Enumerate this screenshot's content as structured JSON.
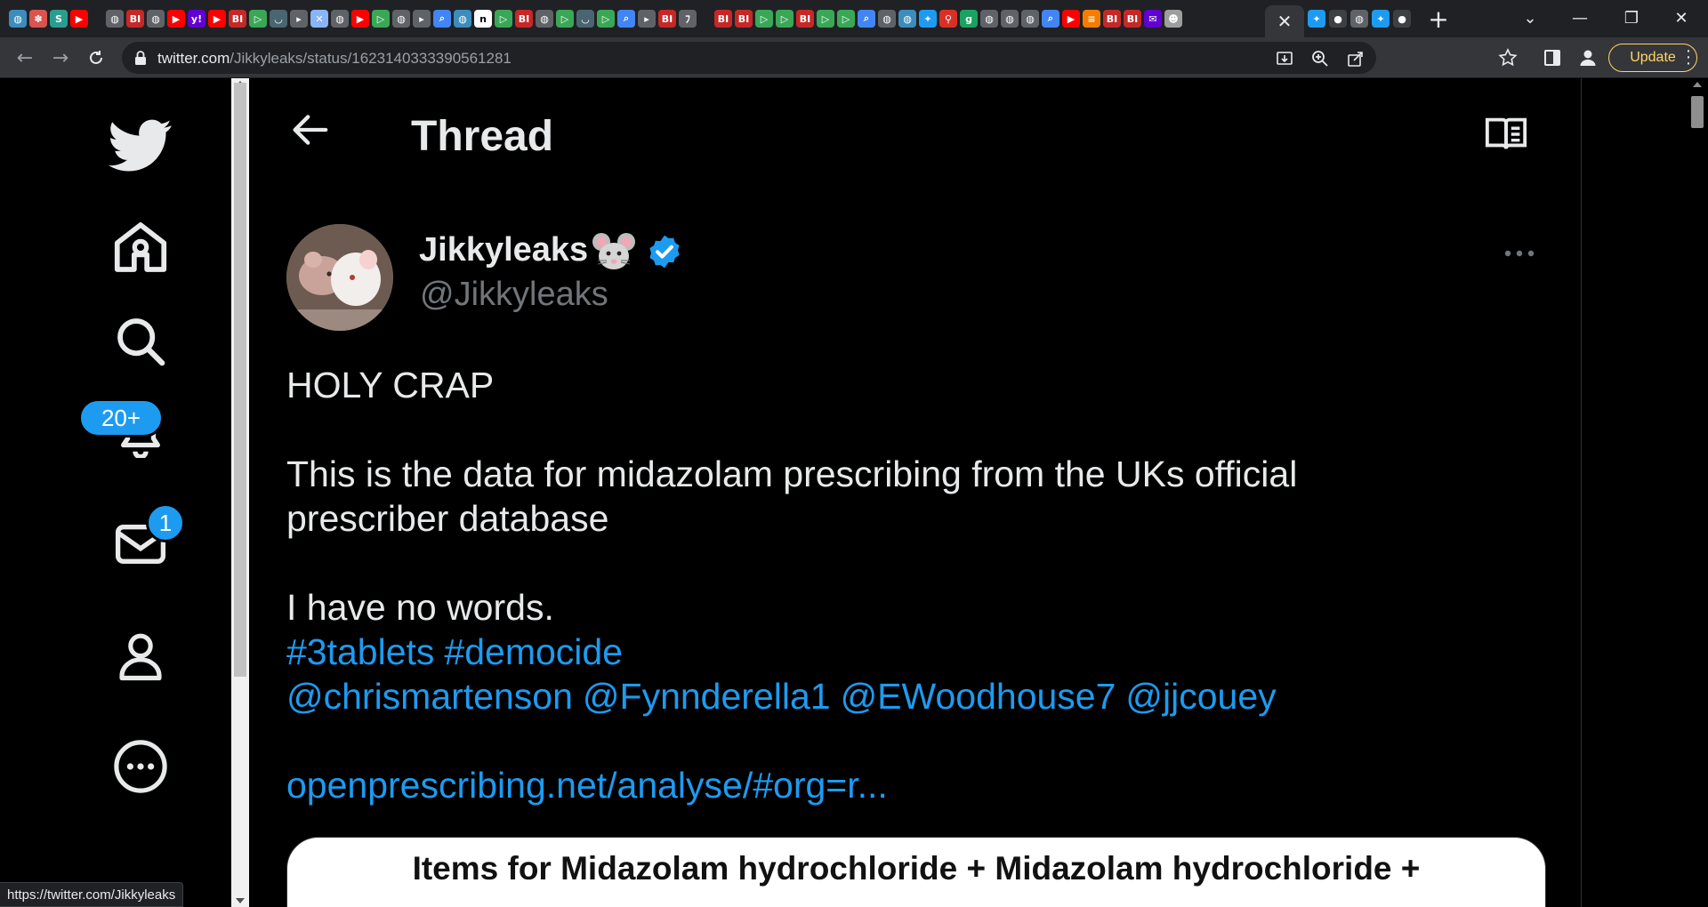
{
  "browser": {
    "url_host": "twitter.com",
    "url_path": "/Jikkyleaks/status/1623140333390561281",
    "update_label": "Update",
    "status_url": "https://twitter.com/Jikkyleaks",
    "tab_favicons": [
      {
        "icon": "globe-icon",
        "glyph": "◍",
        "color": "#3c8dbc"
      },
      {
        "icon": "paw-icon",
        "glyph": "✽",
        "color": "#d9534f"
      },
      {
        "icon": "stat-icon",
        "glyph": "S",
        "color": "#2a9d8f"
      },
      {
        "icon": "youtube-icon",
        "glyph": "▶",
        "color": "#ff0000"
      },
      {
        "icon": "sep",
        "glyph": "",
        "color": ""
      },
      {
        "icon": "globe-icon",
        "glyph": "◍",
        "color": "#5f6368"
      },
      {
        "icon": "bi-icon",
        "glyph": "BI",
        "color": "#c62828"
      },
      {
        "icon": "globe-icon",
        "glyph": "◍",
        "color": "#5f6368"
      },
      {
        "icon": "youtube-icon",
        "glyph": "▶",
        "color": "#ff0000"
      },
      {
        "icon": "yahoo-icon",
        "glyph": "y!",
        "color": "#6001d2"
      },
      {
        "icon": "youtube-icon",
        "glyph": "▶",
        "color": "#ff0000"
      },
      {
        "icon": "bi-icon",
        "glyph": "BI",
        "color": "#c62828"
      },
      {
        "icon": "play-icon",
        "glyph": "▷",
        "color": "#3aa757"
      },
      {
        "icon": "shield-icon",
        "glyph": "◡",
        "color": "#4a6572"
      },
      {
        "icon": "docs-icon",
        "glyph": "▸",
        "color": "#5f6368"
      },
      {
        "icon": "puzzle-icon",
        "glyph": "✕",
        "color": "#8ab4f8"
      },
      {
        "icon": "globe-icon",
        "glyph": "◍",
        "color": "#5f6368"
      },
      {
        "icon": "youtube-icon",
        "glyph": "▶",
        "color": "#ff0000"
      },
      {
        "icon": "play-icon",
        "glyph": "▷",
        "color": "#3aa757"
      },
      {
        "icon": "globe-icon",
        "glyph": "◍",
        "color": "#5f6368"
      },
      {
        "icon": "docs-icon",
        "glyph": "▸",
        "color": "#5f6368"
      },
      {
        "icon": "search-icon",
        "glyph": "⌕",
        "color": "#4285f4"
      },
      {
        "icon": "globe-icon",
        "glyph": "◍",
        "color": "#3c8dbc"
      },
      {
        "icon": "n-icon",
        "glyph": "n",
        "color": "#000000"
      },
      {
        "icon": "play-icon",
        "glyph": "▷",
        "color": "#3aa757"
      },
      {
        "icon": "bi-icon",
        "glyph": "BI",
        "color": "#c62828"
      },
      {
        "icon": "globe-icon",
        "glyph": "◍",
        "color": "#5f6368"
      },
      {
        "icon": "play-icon",
        "glyph": "▷",
        "color": "#3aa757"
      },
      {
        "icon": "shield-icon",
        "glyph": "◡",
        "color": "#4a6572"
      },
      {
        "icon": "play-icon",
        "glyph": "▷",
        "color": "#3aa757"
      },
      {
        "icon": "search-icon",
        "glyph": "⌕",
        "color": "#4285f4"
      },
      {
        "icon": "docs-icon",
        "glyph": "▸",
        "color": "#5f6368"
      },
      {
        "icon": "bi-icon",
        "glyph": "BI",
        "color": "#c62828"
      },
      {
        "icon": "text-icon",
        "glyph": "ﾌ",
        "color": "#5f6368"
      },
      {
        "icon": "sep",
        "glyph": "",
        "color": ""
      },
      {
        "icon": "bi-icon",
        "glyph": "BI",
        "color": "#c62828"
      },
      {
        "icon": "bi-icon",
        "glyph": "BI",
        "color": "#c62828"
      },
      {
        "icon": "play-icon",
        "glyph": "▷",
        "color": "#3aa757"
      },
      {
        "icon": "play-icon",
        "glyph": "▷",
        "color": "#3aa757"
      },
      {
        "icon": "bi-icon",
        "glyph": "BI",
        "color": "#c62828"
      },
      {
        "icon": "play-icon",
        "glyph": "▷",
        "color": "#3aa757"
      },
      {
        "icon": "play-icon",
        "glyph": "▷",
        "color": "#3aa757"
      },
      {
        "icon": "search-icon",
        "glyph": "⌕",
        "color": "#4285f4"
      },
      {
        "icon": "globe-icon",
        "glyph": "◍",
        "color": "#5f6368"
      },
      {
        "icon": "globe-icon",
        "glyph": "◍",
        "color": "#3c8dbc"
      },
      {
        "icon": "twitter-icon",
        "glyph": "✦",
        "color": "#1d9bf0"
      },
      {
        "icon": "pin-icon",
        "glyph": "⚲",
        "color": "#d93025"
      },
      {
        "icon": "g-icon",
        "glyph": "g",
        "color": "#1aa260"
      },
      {
        "icon": "globe-icon",
        "glyph": "◍",
        "color": "#5f6368"
      },
      {
        "icon": "globe-icon",
        "glyph": "◍",
        "color": "#5f6368"
      },
      {
        "icon": "globe-icon",
        "glyph": "◍",
        "color": "#5f6368"
      },
      {
        "icon": "search-icon",
        "glyph": "⌕",
        "color": "#4285f4"
      },
      {
        "icon": "youtube-icon",
        "glyph": "▶",
        "color": "#ff0000"
      },
      {
        "icon": "bookmark-icon",
        "glyph": "≡",
        "color": "#f57c00"
      },
      {
        "icon": "bi-icon",
        "glyph": "BI",
        "color": "#c62828"
      },
      {
        "icon": "bi-icon",
        "glyph": "BI",
        "color": "#c62828"
      },
      {
        "icon": "mail-icon",
        "glyph": "✉",
        "color": "#6001d2"
      },
      {
        "icon": "avatar-icon",
        "glyph": "☻",
        "color": "#9e9e9e"
      }
    ],
    "tab_favicons_after": [
      {
        "icon": "twitter-icon",
        "glyph": "✦",
        "color": "#1d9bf0"
      },
      {
        "icon": "circle-icon",
        "glyph": "●",
        "color": "#3c4043"
      },
      {
        "icon": "globe-icon",
        "glyph": "◍",
        "color": "#5f6368"
      },
      {
        "icon": "twitter-icon",
        "glyph": "✦",
        "color": "#1d9bf0"
      },
      {
        "icon": "circle-icon",
        "glyph": "●",
        "color": "#3c4043"
      }
    ]
  },
  "nav": {
    "notifications_badge": "20+",
    "messages_badge": "1"
  },
  "thread": {
    "title": "Thread"
  },
  "tweet": {
    "author_name": "Jikkyleaks",
    "author_handle": "@Jikkyleaks",
    "line1": "HOLY CRAP",
    "line2": "This is the data for midazolam prescribing from the UKs official",
    "line3": "prescriber database",
    "line4": "I have no words.",
    "hashtags": [
      "#3tablets",
      "#democide"
    ],
    "mentions": [
      "@chrismartenson",
      "@Fynnderella1",
      "@EWoodhouse7",
      "@jjcouey"
    ],
    "link": "openprescribing.net/analyse/#org=r..."
  },
  "card": {
    "title": "Items for Midazolam hydrochloride + Midazolam hydrochloride +"
  },
  "colors": {
    "accent": "#1d9bf0",
    "text": "#e7e9ea",
    "muted": "#71767b",
    "update": "#fdd663"
  }
}
